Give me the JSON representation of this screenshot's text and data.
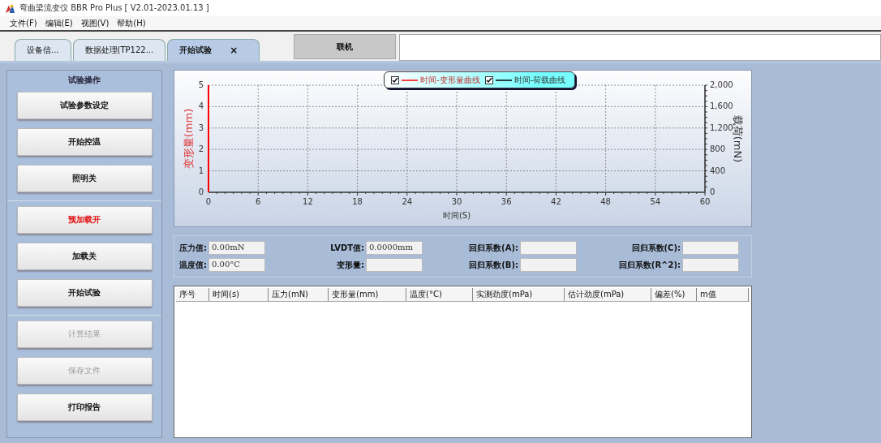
{
  "window": {
    "title": "弯曲梁流变仪 BBR Pro Plus [ V2.01-2023.01.13 ]"
  },
  "menu": [
    "文件(F)",
    "编辑(E)",
    "视图(V)",
    "帮助(H)"
  ],
  "tabs": [
    {
      "label": "设备信...",
      "selected": false,
      "closable": false
    },
    {
      "label": "数据处理(TP122...",
      "selected": false,
      "closable": false
    },
    {
      "label": "开始试验",
      "selected": true,
      "closable": true,
      "close": "×"
    }
  ],
  "connect_button": "联机",
  "operations": {
    "title": "试验操作",
    "groups": [
      [
        {
          "label": "试验参数设定",
          "disabled": false,
          "alert": false
        },
        {
          "label": "开始控温",
          "disabled": false,
          "alert": false
        },
        {
          "label": "照明关",
          "disabled": false,
          "alert": false
        }
      ],
      [
        {
          "label": "预加载开",
          "disabled": false,
          "alert": true
        },
        {
          "label": "加载关",
          "disabled": false,
          "alert": false
        },
        {
          "label": "开始试验",
          "disabled": false,
          "alert": false
        }
      ],
      [
        {
          "label": "计算结果",
          "disabled": true,
          "alert": false
        },
        {
          "label": "保存文件",
          "disabled": true,
          "alert": false
        },
        {
          "label": "打印报告",
          "disabled": false,
          "alert": false
        }
      ]
    ]
  },
  "chart": {
    "legend": [
      {
        "checked": true
      },
      {
        "checked": true
      }
    ],
    "chart_data": {
      "type": "line",
      "xlabel": "时间(S)",
      "ylabel": "变形量(mm)",
      "y2label": "载荷(mN)",
      "grid": true,
      "categories": [
        "0",
        "6",
        "12",
        "18",
        "24",
        "30",
        "36",
        "42",
        "48",
        "54",
        "60"
      ],
      "ylim": [
        0,
        5
      ],
      "yticks": [
        0,
        1,
        2,
        3,
        4,
        5
      ],
      "y2lim": [
        0,
        2000
      ],
      "y2ticks": [
        {
          "value": 0,
          "label": "0"
        },
        {
          "value": 400,
          "label": "400"
        },
        {
          "value": 800,
          "label": "800"
        },
        {
          "value": 1200,
          "label": "1,200"
        },
        {
          "value": 1600,
          "label": "1,600"
        },
        {
          "value": 2000,
          "label": "2,000"
        }
      ],
      "series": [
        {
          "name": "时间-变形量曲线",
          "color": "#ff0000",
          "values": [
            null,
            null,
            null,
            null,
            null,
            null,
            null,
            null,
            null,
            null,
            null
          ]
        },
        {
          "name": "时间-荷载曲线",
          "color": "#000000",
          "values": [
            null,
            null,
            null,
            null,
            null,
            null,
            null,
            null,
            null,
            null,
            null
          ]
        }
      ]
    }
  },
  "readings": [
    {
      "label": "压力值:",
      "value": "0.00mN"
    },
    {
      "label": "LVDT值:",
      "value": "0.0000mm"
    },
    {
      "label": "回归系数(A):"
    },
    {
      "label": "回归系数(C):"
    },
    {
      "label": "温度值:",
      "value": "0.00°C"
    },
    {
      "label": "变形量:"
    },
    {
      "label": "回归系数(B):"
    },
    {
      "label": "回归系数(R^2):"
    }
  ],
  "table": {
    "columns": [
      "序号",
      "时间(s)",
      "压力(mN)",
      "变形量(mm)",
      "温度(°C)",
      "实测劲度(mPa)",
      "估计劲度(mPa)",
      "偏差(%)",
      "m值"
    ]
  }
}
